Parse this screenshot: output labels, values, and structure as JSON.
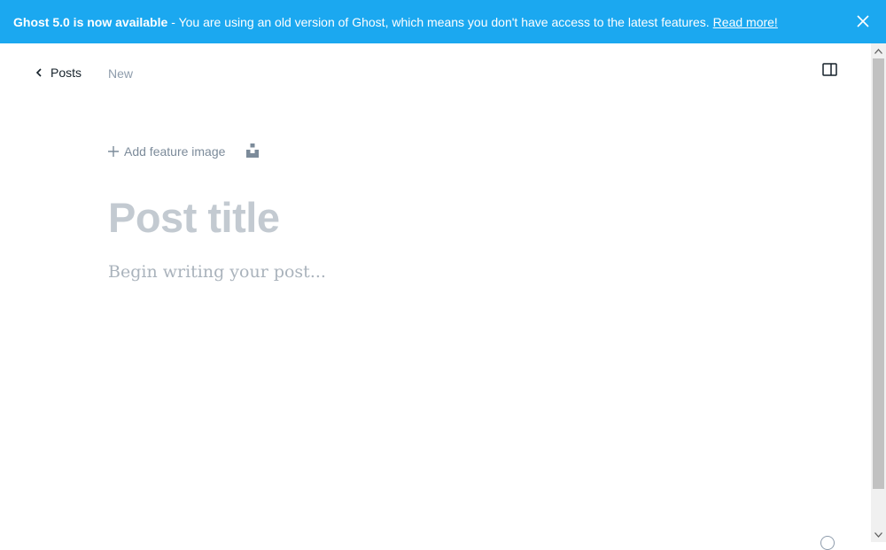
{
  "banner": {
    "bold_text": "Ghost 5.0 is now available",
    "message": "- You are using an old version of Ghost, which means you don't have access to the latest features.",
    "link_text": "Read more!",
    "background_color": "#1ba8f0"
  },
  "header": {
    "back_label": "Posts",
    "status": "New"
  },
  "editor": {
    "add_feature_image": "Add feature image",
    "title_placeholder": "Post title",
    "body_placeholder": "Begin writing your post..."
  },
  "icons": {
    "back": "chevron-left-icon",
    "close": "close-icon",
    "settings": "sidebar-toggle-icon",
    "plus": "plus-icon",
    "unsplash": "unsplash-icon",
    "help": "help-circle-icon"
  }
}
